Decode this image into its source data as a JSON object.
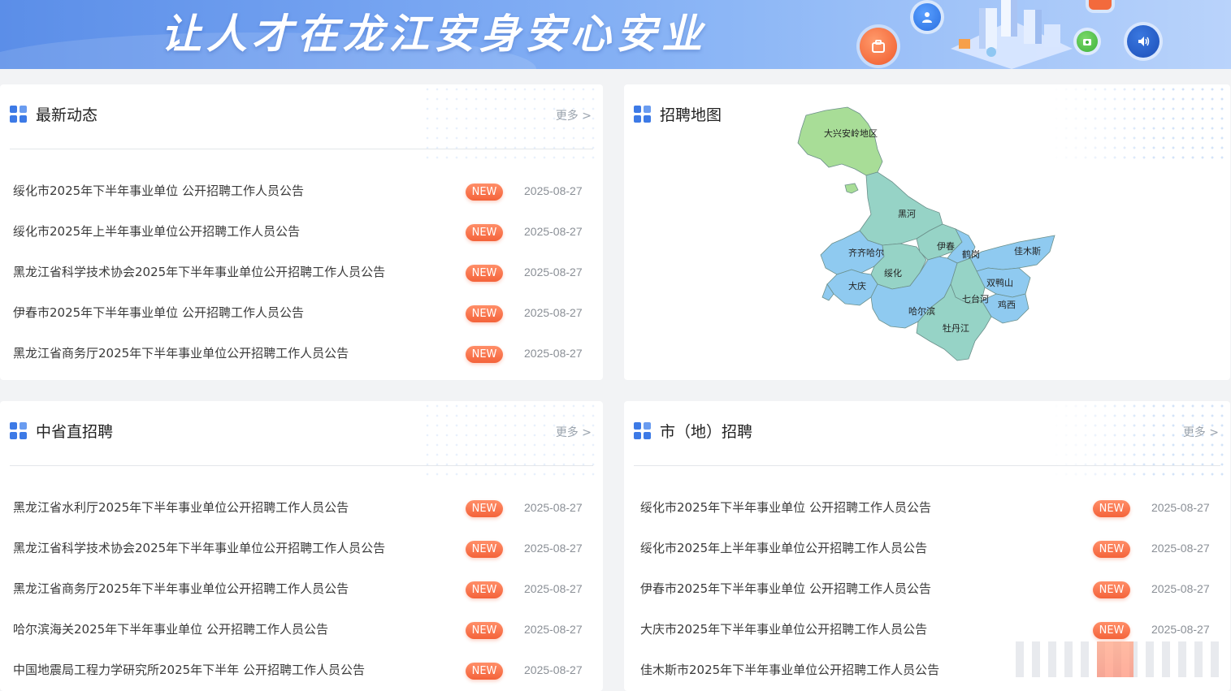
{
  "banner": {
    "slogan": "让人才在龙江安身安心安业",
    "icons": [
      "briefcase-icon",
      "user-icon",
      "camera-icon",
      "speaker-icon"
    ]
  },
  "news": {
    "title": "最新动态",
    "more": "更多 >",
    "items": [
      {
        "title": "绥化市2025年下半年事业单位 公开招聘工作人员公告",
        "badge": "NEW",
        "date": "2025-08-27"
      },
      {
        "title": "绥化市2025年上半年事业单位公开招聘工作人员公告",
        "badge": "NEW",
        "date": "2025-08-27"
      },
      {
        "title": "黑龙江省科学技术协会2025年下半年事业单位公开招聘工作人员公告",
        "badge": "NEW",
        "date": "2025-08-27"
      },
      {
        "title": "伊春市2025年下半年事业单位 公开招聘工作人员公告",
        "badge": "NEW",
        "date": "2025-08-27"
      },
      {
        "title": "黑龙江省商务厅2025年下半年事业单位公开招聘工作人员公告",
        "badge": "NEW",
        "date": "2025-08-27"
      }
    ]
  },
  "map": {
    "title": "招聘地图",
    "regions": [
      "大兴安岭地区",
      "黑河",
      "伊春",
      "鹤岗",
      "佳木斯",
      "齐齐哈尔",
      "绥化",
      "双鸭山",
      "大庆",
      "七台河",
      "哈尔滨",
      "鸡西",
      "牡丹江"
    ],
    "colors": {
      "green": "#a8dd97",
      "teal": "#96d3c6",
      "blue": "#8fcaf0"
    }
  },
  "provincial": {
    "title": "中省直招聘",
    "more": "更多 >",
    "items": [
      {
        "title": "黑龙江省水利厅2025年下半年事业单位公开招聘工作人员公告",
        "badge": "NEW",
        "date": "2025-08-27"
      },
      {
        "title": "黑龙江省科学技术协会2025年下半年事业单位公开招聘工作人员公告",
        "badge": "NEW",
        "date": "2025-08-27"
      },
      {
        "title": "黑龙江省商务厅2025年下半年事业单位公开招聘工作人员公告",
        "badge": "NEW",
        "date": "2025-08-27"
      },
      {
        "title": "哈尔滨海关2025年下半年事业单位 公开招聘工作人员公告",
        "badge": "NEW",
        "date": "2025-08-27"
      },
      {
        "title": "中国地震局工程力学研究所2025年下半年 公开招聘工作人员公告",
        "badge": "NEW",
        "date": "2025-08-27"
      }
    ]
  },
  "city": {
    "title": "市（地）招聘",
    "more": "更多 >",
    "items": [
      {
        "title": "绥化市2025年下半年事业单位 公开招聘工作人员公告",
        "badge": "NEW",
        "date": "2025-08-27"
      },
      {
        "title": "绥化市2025年上半年事业单位公开招聘工作人员公告",
        "badge": "NEW",
        "date": "2025-08-27"
      },
      {
        "title": "伊春市2025年下半年事业单位 公开招聘工作人员公告",
        "badge": "NEW",
        "date": "2025-08-27"
      },
      {
        "title": "大庆市2025年下半年事业单位公开招聘工作人员公告",
        "badge": "NEW",
        "date": "2025-08-27"
      },
      {
        "title": "佳木斯市2025年下半年事业单位公开招聘工作人员公告",
        "badge": "",
        "date": ""
      }
    ]
  },
  "accent_color": "#3d7ae6",
  "badge_color": "#f4633a"
}
